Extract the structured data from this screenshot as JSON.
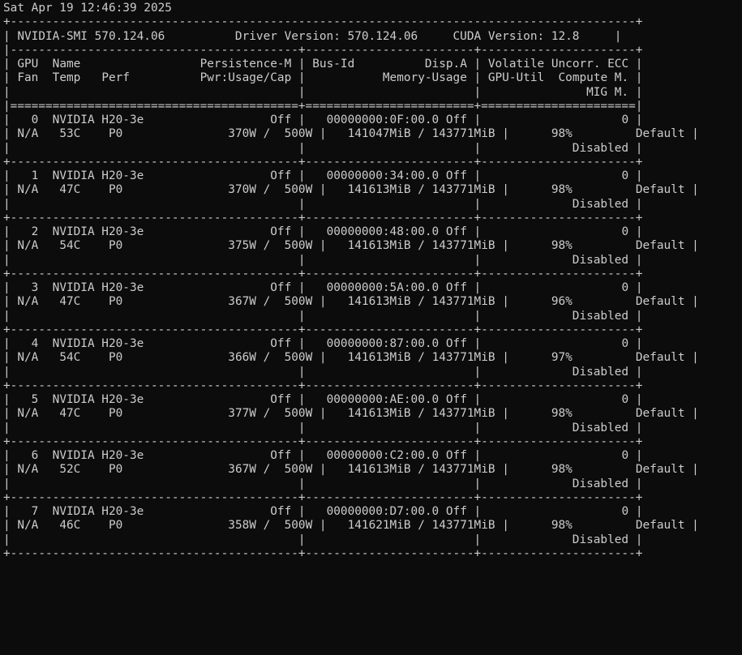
{
  "timestamp": "Sat Apr 19 12:46:39 2025",
  "header": {
    "tool": "NVIDIA-SMI 570.124.06",
    "driver": "Driver Version: 570.124.06",
    "cuda": "CUDA Version: 12.8"
  },
  "columns": {
    "row1": [
      "GPU",
      "Name",
      "Persistence-M",
      "Bus-Id",
      "Disp.A",
      "Volatile Uncorr. ECC"
    ],
    "row2": [
      "Fan",
      "Temp",
      "Perf",
      "Pwr:Usage/Cap",
      "Memory-Usage",
      "GPU-Util",
      "Compute M."
    ],
    "row3": [
      "MIG M."
    ]
  },
  "gpus": [
    {
      "index": "0",
      "name": "NVIDIA H20-3e",
      "persistence": "Off",
      "bus_id": "00000000:0F:00.0",
      "disp": "Off",
      "ecc": "0",
      "fan": "N/A",
      "temp": "53C",
      "perf": "P0",
      "pwr_usage": "370W",
      "pwr_cap": "500W",
      "mem_used": "141047MiB",
      "mem_total": "143771MiB",
      "util": "98%",
      "compute_mode": "Default",
      "mig": "Disabled"
    },
    {
      "index": "1",
      "name": "NVIDIA H20-3e",
      "persistence": "Off",
      "bus_id": "00000000:34:00.0",
      "disp": "Off",
      "ecc": "0",
      "fan": "N/A",
      "temp": "47C",
      "perf": "P0",
      "pwr_usage": "370W",
      "pwr_cap": "500W",
      "mem_used": "141613MiB",
      "mem_total": "143771MiB",
      "util": "98%",
      "compute_mode": "Default",
      "mig": "Disabled"
    },
    {
      "index": "2",
      "name": "NVIDIA H20-3e",
      "persistence": "Off",
      "bus_id": "00000000:48:00.0",
      "disp": "Off",
      "ecc": "0",
      "fan": "N/A",
      "temp": "54C",
      "perf": "P0",
      "pwr_usage": "375W",
      "pwr_cap": "500W",
      "mem_used": "141613MiB",
      "mem_total": "143771MiB",
      "util": "98%",
      "compute_mode": "Default",
      "mig": "Disabled"
    },
    {
      "index": "3",
      "name": "NVIDIA H20-3e",
      "persistence": "Off",
      "bus_id": "00000000:5A:00.0",
      "disp": "Off",
      "ecc": "0",
      "fan": "N/A",
      "temp": "47C",
      "perf": "P0",
      "pwr_usage": "367W",
      "pwr_cap": "500W",
      "mem_used": "141613MiB",
      "mem_total": "143771MiB",
      "util": "96%",
      "compute_mode": "Default",
      "mig": "Disabled"
    },
    {
      "index": "4",
      "name": "NVIDIA H20-3e",
      "persistence": "Off",
      "bus_id": "00000000:87:00.0",
      "disp": "Off",
      "ecc": "0",
      "fan": "N/A",
      "temp": "54C",
      "perf": "P0",
      "pwr_usage": "366W",
      "pwr_cap": "500W",
      "mem_used": "141613MiB",
      "mem_total": "143771MiB",
      "util": "97%",
      "compute_mode": "Default",
      "mig": "Disabled"
    },
    {
      "index": "5",
      "name": "NVIDIA H20-3e",
      "persistence": "Off",
      "bus_id": "00000000:AE:00.0",
      "disp": "Off",
      "ecc": "0",
      "fan": "N/A",
      "temp": "47C",
      "perf": "P0",
      "pwr_usage": "377W",
      "pwr_cap": "500W",
      "mem_used": "141613MiB",
      "mem_total": "143771MiB",
      "util": "98%",
      "compute_mode": "Default",
      "mig": "Disabled"
    },
    {
      "index": "6",
      "name": "NVIDIA H20-3e",
      "persistence": "Off",
      "bus_id": "00000000:C2:00.0",
      "disp": "Off",
      "ecc": "0",
      "fan": "N/A",
      "temp": "52C",
      "perf": "P0",
      "pwr_usage": "367W",
      "pwr_cap": "500W",
      "mem_used": "141613MiB",
      "mem_total": "143771MiB",
      "util": "98%",
      "compute_mode": "Default",
      "mig": "Disabled"
    },
    {
      "index": "7",
      "name": "NVIDIA H20-3e",
      "persistence": "Off",
      "bus_id": "00000000:D7:00.0",
      "disp": "Off",
      "ecc": "0",
      "fan": "N/A",
      "temp": "46C",
      "perf": "P0",
      "pwr_usage": "358W",
      "pwr_cap": "500W",
      "mem_used": "141621MiB",
      "mem_total": "143771MiB",
      "util": "98%",
      "compute_mode": "Default",
      "mig": "Disabled"
    }
  ]
}
